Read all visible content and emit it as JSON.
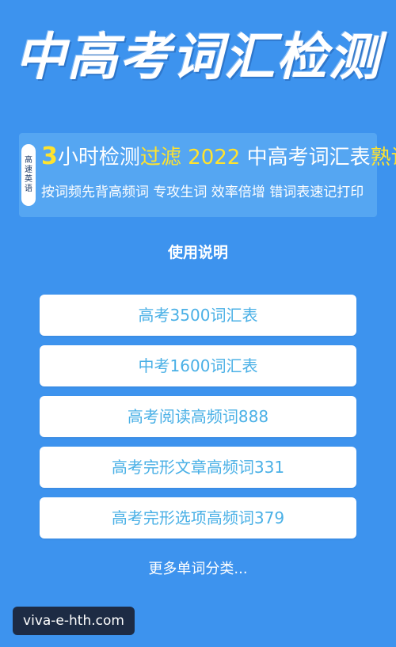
{
  "banner": {
    "title": "中高考词汇检测",
    "seal_text": "高速英语",
    "promo": {
      "part1_num": "3",
      "part1_text": "小时检测",
      "part2": "过滤 2022",
      "part3": " 中高考词汇表",
      "part4": "熟词",
      "line2": "按词频先背高频词  专攻生词  效率倍增  错词表速记打印"
    }
  },
  "usage_label": "使用说明",
  "menu": {
    "items": [
      {
        "label": "高考3500词汇表"
      },
      {
        "label": "中考1600词汇表"
      },
      {
        "label": "高考阅读高频词888"
      },
      {
        "label": "高考完形文章高频词331"
      },
      {
        "label": "高考完形选项高频词379"
      }
    ]
  },
  "more_label": "更多单词分类...",
  "watermark": "viva-e-hth.com",
  "colors": {
    "background": "#3d93ee",
    "button_text": "#4ab0e6",
    "highlight": "#ffe32e"
  }
}
